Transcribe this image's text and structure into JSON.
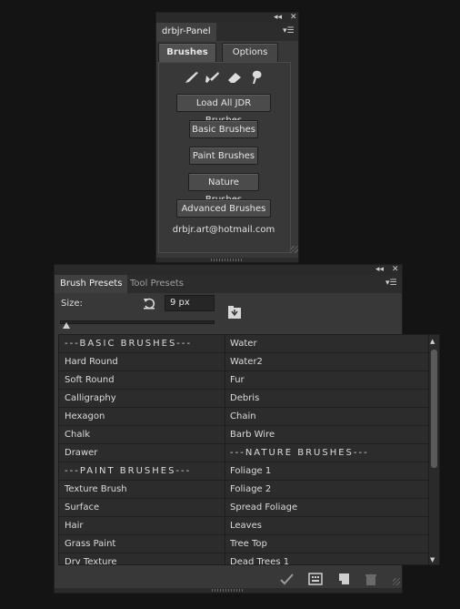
{
  "jdr_panel": {
    "title": "drbjr-Panel",
    "tabs": [
      {
        "label": "Brushes",
        "active": true
      },
      {
        "label": "Options",
        "active": false
      }
    ],
    "tool_icons": [
      "brush-icon",
      "paint-brush-icon",
      "eraser-icon",
      "smudge-icon"
    ],
    "buttons": {
      "load_all": "Load All JDR Brushes",
      "basic": "Basic Brushes",
      "paint": "Paint Brushes",
      "nature": "Nature Brushes",
      "advanced": "Advanced Brushes"
    },
    "email": "drbjr.art@hotmail.com"
  },
  "presets_panel": {
    "tabs": [
      {
        "label": "Brush Presets",
        "active": true
      },
      {
        "label": "Tool Presets",
        "active": false
      }
    ],
    "size_label": "Size:",
    "size_value": "9 px",
    "rows": [
      [
        "---BASIC BRUSHES---",
        "Water"
      ],
      [
        "Hard Round",
        "Water2"
      ],
      [
        "Soft Round",
        "Fur"
      ],
      [
        "Calligraphy",
        "Debris"
      ],
      [
        "Hexagon",
        "Chain"
      ],
      [
        "Chalk",
        "Barb Wire"
      ],
      [
        "Drawer",
        "---NATURE BRUSHES---"
      ],
      [
        "---PAINT BRUSHES---",
        "Foliage 1"
      ],
      [
        "Texture Brush",
        "Foliage 2"
      ],
      [
        "Surface",
        "Spread Foliage"
      ],
      [
        "Hair",
        "Leaves"
      ],
      [
        "Grass Paint",
        "Tree Top"
      ],
      [
        "Dry Texture",
        "Dead Trees 1"
      ]
    ]
  },
  "colors": {
    "panel": "#383838",
    "background": "#141414",
    "button": "#4b4b4b"
  }
}
